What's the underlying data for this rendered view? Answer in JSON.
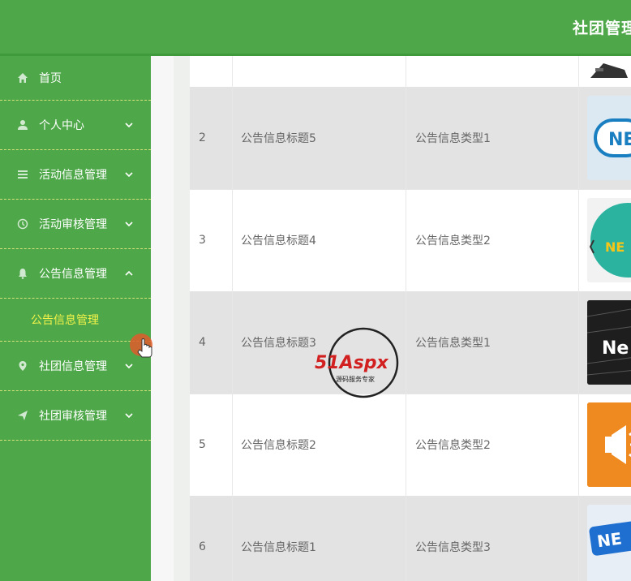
{
  "header": {
    "title": "社团管理"
  },
  "sidebar": {
    "items": [
      {
        "label": "首页",
        "icon": "home-icon"
      },
      {
        "label": "个人中心",
        "icon": "user-icon"
      },
      {
        "label": "活动信息管理",
        "icon": "list-icon"
      },
      {
        "label": "活动审核管理",
        "icon": "clock-icon"
      },
      {
        "label": "公告信息管理",
        "icon": "bell-icon"
      },
      {
        "label": "社团信息管理",
        "icon": "location-icon"
      },
      {
        "label": "社团审核管理",
        "icon": "send-icon"
      }
    ],
    "submenu": {
      "label": "公告信息管理"
    },
    "colors": {
      "background": "#4ea849",
      "active_sub": "#f2f24a",
      "divider": "#d8e27a"
    }
  },
  "table": {
    "rows": [
      {
        "id": "2",
        "title": "公告信息标题5",
        "type": "公告信息类型1",
        "thumb_text": "NE"
      },
      {
        "id": "3",
        "title": "公告信息标题4",
        "type": "公告信息类型2",
        "thumb_text": "NE"
      },
      {
        "id": "4",
        "title": "公告信息标题3",
        "type": "公告信息类型1",
        "thumb_text": "Ne"
      },
      {
        "id": "5",
        "title": "公告信息标题2",
        "type": "公告信息类型2",
        "thumb_text": ""
      },
      {
        "id": "6",
        "title": "公告信息标题1",
        "type": "公告信息类型3",
        "thumb_text": "NE"
      }
    ]
  },
  "watermark": {
    "brand": "51Aspx",
    "tagline": "源码服务专家"
  }
}
